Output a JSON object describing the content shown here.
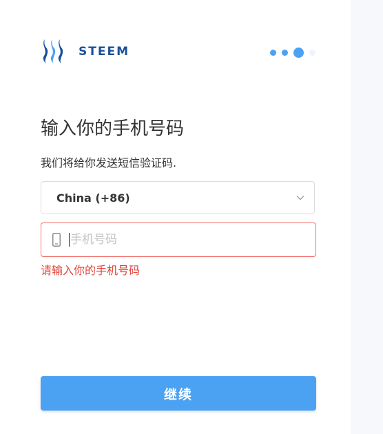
{
  "brand": {
    "name": "STEEM",
    "logo_icon": "steem-logo-icon",
    "color": "#1a5099"
  },
  "progress": {
    "total_steps": 4,
    "current_step": 3,
    "active_color": "#4ba2f2",
    "pending_color": "#edf4fc"
  },
  "form": {
    "title": "输入你的手机号码",
    "subtitle": "我们将给你发送短信验证码.",
    "country_select": {
      "selected": "China (+86)",
      "icon": "chevron-down-icon"
    },
    "phone_input": {
      "value": "",
      "placeholder": "手机号码",
      "icon": "mobile-phone-icon"
    },
    "error_message": "请输入你的手机号码",
    "error_color": "#e0443b",
    "continue_label": "继续",
    "accent_color": "#4ba2f2"
  }
}
